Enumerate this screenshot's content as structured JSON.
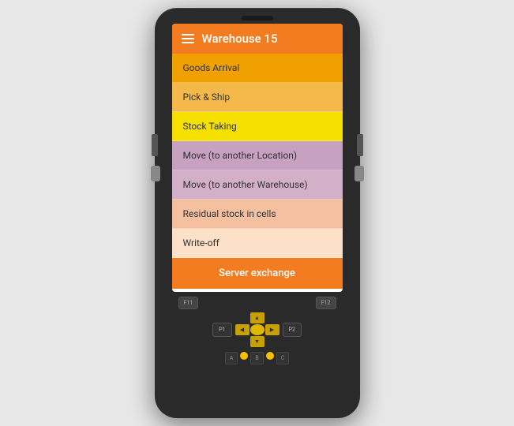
{
  "header": {
    "title": "Warehouse 15",
    "menu_icon": "hamburger"
  },
  "menu": {
    "items": [
      {
        "id": "goods-arrival",
        "label": "Goods Arrival",
        "color_class": "goods-arrival"
      },
      {
        "id": "pick-ship",
        "label": "Pick & Ship",
        "color_class": "pick-ship"
      },
      {
        "id": "stock-taking",
        "label": "Stock Taking",
        "color_class": "stock-taking"
      },
      {
        "id": "move-location",
        "label": "Move (to another Location)",
        "color_class": "move-location"
      },
      {
        "id": "move-warehouse",
        "label": "Move (to another Warehouse)",
        "color_class": "move-warehouse"
      },
      {
        "id": "residual",
        "label": "Residual stock in cells",
        "color_class": "residual"
      },
      {
        "id": "writeoff",
        "label": "Write-off",
        "color_class": "writeoff"
      }
    ],
    "server_exchange": "Server exchange"
  },
  "keypad": {
    "fn_keys": [
      "F11",
      "F12"
    ],
    "p_keys": [
      "P1",
      "P2"
    ],
    "abc_keys": [
      "A",
      "B",
      "C"
    ]
  }
}
